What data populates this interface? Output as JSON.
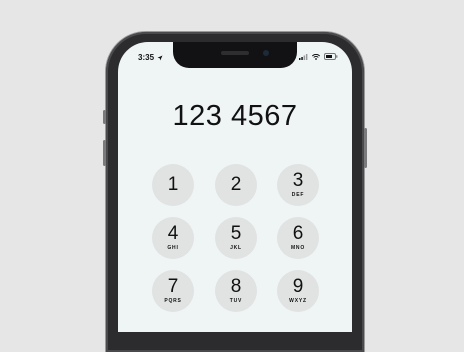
{
  "status": {
    "time": "3:35"
  },
  "display": {
    "number": "123 4567"
  },
  "keypad": [
    {
      "digit": "1",
      "letters": ""
    },
    {
      "digit": "2",
      "letters": ""
    },
    {
      "digit": "3",
      "letters": "DEF"
    },
    {
      "digit": "4",
      "letters": "GHI"
    },
    {
      "digit": "5",
      "letters": "JKL"
    },
    {
      "digit": "6",
      "letters": "MNO"
    },
    {
      "digit": "7",
      "letters": "PQRS"
    },
    {
      "digit": "8",
      "letters": "TUV"
    },
    {
      "digit": "9",
      "letters": "WXYZ"
    }
  ],
  "colors": {
    "screen": "#eff5f5",
    "key": "#e1e2e2",
    "frame": "#2c2c2e",
    "background": "#e6e6e6"
  }
}
